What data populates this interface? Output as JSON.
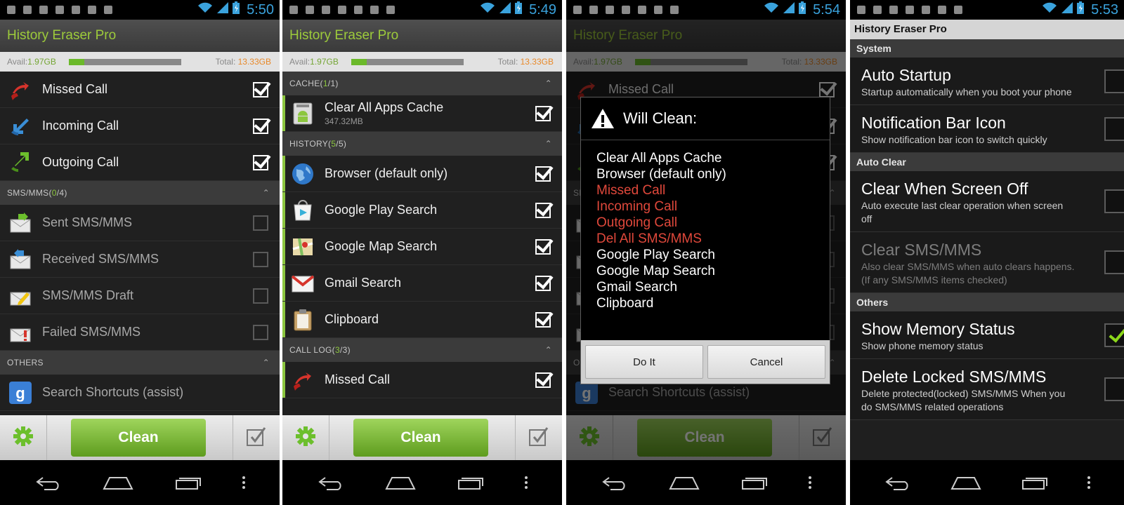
{
  "colors": {
    "accent_green": "#8cc63f",
    "status_blue": "#3aa2dc",
    "warning_red": "#e0483b",
    "title_green": "#9dcb3b"
  },
  "status_times": [
    "5:50",
    "5:49",
    "5:54",
    "5:53"
  ],
  "app_title": "History Eraser Pro",
  "memory": {
    "avail_label": "Avail:",
    "avail_value": "1.97GB",
    "total_label": "Total:",
    "total_value": "13.33GB",
    "used_fraction": 0.14
  },
  "screen1": {
    "calls": [
      {
        "label": "Missed Call",
        "icon": "missed-call-icon",
        "checked": true
      },
      {
        "label": "Incoming Call",
        "icon": "incoming-call-icon",
        "checked": true
      },
      {
        "label": "Outgoing Call",
        "icon": "outgoing-call-icon",
        "checked": true
      }
    ],
    "sms_section": {
      "title": "SMS/MMS",
      "count": "0",
      "total": "4"
    },
    "sms": [
      {
        "label": "Sent SMS/MMS",
        "icon": "sent-sms-icon",
        "checked": false
      },
      {
        "label": "Received SMS/MMS",
        "icon": "received-sms-icon",
        "checked": false
      },
      {
        "label": "SMS/MMS Draft",
        "icon": "sms-draft-icon",
        "checked": false
      },
      {
        "label": "Failed SMS/MMS",
        "icon": "failed-sms-icon",
        "checked": false
      }
    ],
    "others_section": {
      "title": "OTHERS"
    },
    "others": [
      {
        "label": "Search Shortcuts (assist)",
        "icon": "google-search-icon"
      }
    ]
  },
  "screen2": {
    "cache_section": {
      "title": "CACHE",
      "count": "1",
      "total": "1"
    },
    "cache": [
      {
        "label": "Clear All Apps Cache",
        "sub": "347.32MB",
        "icon": "android-cache-icon",
        "checked": true
      }
    ],
    "history_section": {
      "title": "HISTORY",
      "count": "5",
      "total": "5"
    },
    "history": [
      {
        "label": "Browser (default only)",
        "icon": "browser-globe-icon",
        "checked": true
      },
      {
        "label": "Google Play Search",
        "icon": "google-play-icon",
        "checked": true
      },
      {
        "label": "Google Map Search",
        "icon": "google-maps-icon",
        "checked": true
      },
      {
        "label": "Gmail Search",
        "icon": "gmail-icon",
        "checked": true
      },
      {
        "label": "Clipboard",
        "icon": "clipboard-icon",
        "checked": true
      }
    ],
    "calllog_section": {
      "title": "CALL LOG",
      "count": "3",
      "total": "3"
    },
    "calllog": [
      {
        "label": "Missed Call",
        "icon": "missed-call-icon",
        "checked": true
      }
    ]
  },
  "clean_label": "Clean",
  "dialog": {
    "title": "Will Clean:",
    "items": [
      {
        "text": "Clear All Apps Cache",
        "danger": false
      },
      {
        "text": "Browser (default only)",
        "danger": false
      },
      {
        "text": "Missed Call",
        "danger": true
      },
      {
        "text": "Incoming Call",
        "danger": true
      },
      {
        "text": "Outgoing Call",
        "danger": true
      },
      {
        "text": "Del All SMS/MMS",
        "danger": true
      },
      {
        "text": "Google Play Search",
        "danger": false
      },
      {
        "text": "Google Map Search",
        "danger": false
      },
      {
        "text": "Gmail Search",
        "danger": false
      },
      {
        "text": "Clipboard",
        "danger": false
      }
    ],
    "ok_label": "Do It",
    "cancel_label": "Cancel"
  },
  "settings": {
    "title": "History Eraser Pro",
    "categories": [
      {
        "name": "System",
        "items": [
          {
            "title": "Auto Startup",
            "summary": "Startup automatically when you boot your phone",
            "checked": false,
            "enabled": true
          },
          {
            "title": "Notification Bar Icon",
            "summary": "Show notification bar icon to switch quickly",
            "checked": false,
            "enabled": true
          }
        ]
      },
      {
        "name": "Auto Clear",
        "items": [
          {
            "title": "Clear When Screen Off",
            "summary": "Auto execute last clear operation when screen off",
            "checked": false,
            "enabled": true
          },
          {
            "title": "Clear SMS/MMS",
            "summary": "Also clear SMS/MMS when auto clears happens. (If any SMS/MMS items checked)",
            "checked": false,
            "enabled": false
          }
        ]
      },
      {
        "name": "Others",
        "items": [
          {
            "title": "Show Memory Status",
            "summary": "Show phone memory status",
            "checked": true,
            "enabled": true
          },
          {
            "title": "Delete Locked SMS/MMS",
            "summary": "Delete protected(locked) SMS/MMS When you do SMS/MMS related operations",
            "checked": false,
            "enabled": true
          }
        ]
      }
    ]
  }
}
